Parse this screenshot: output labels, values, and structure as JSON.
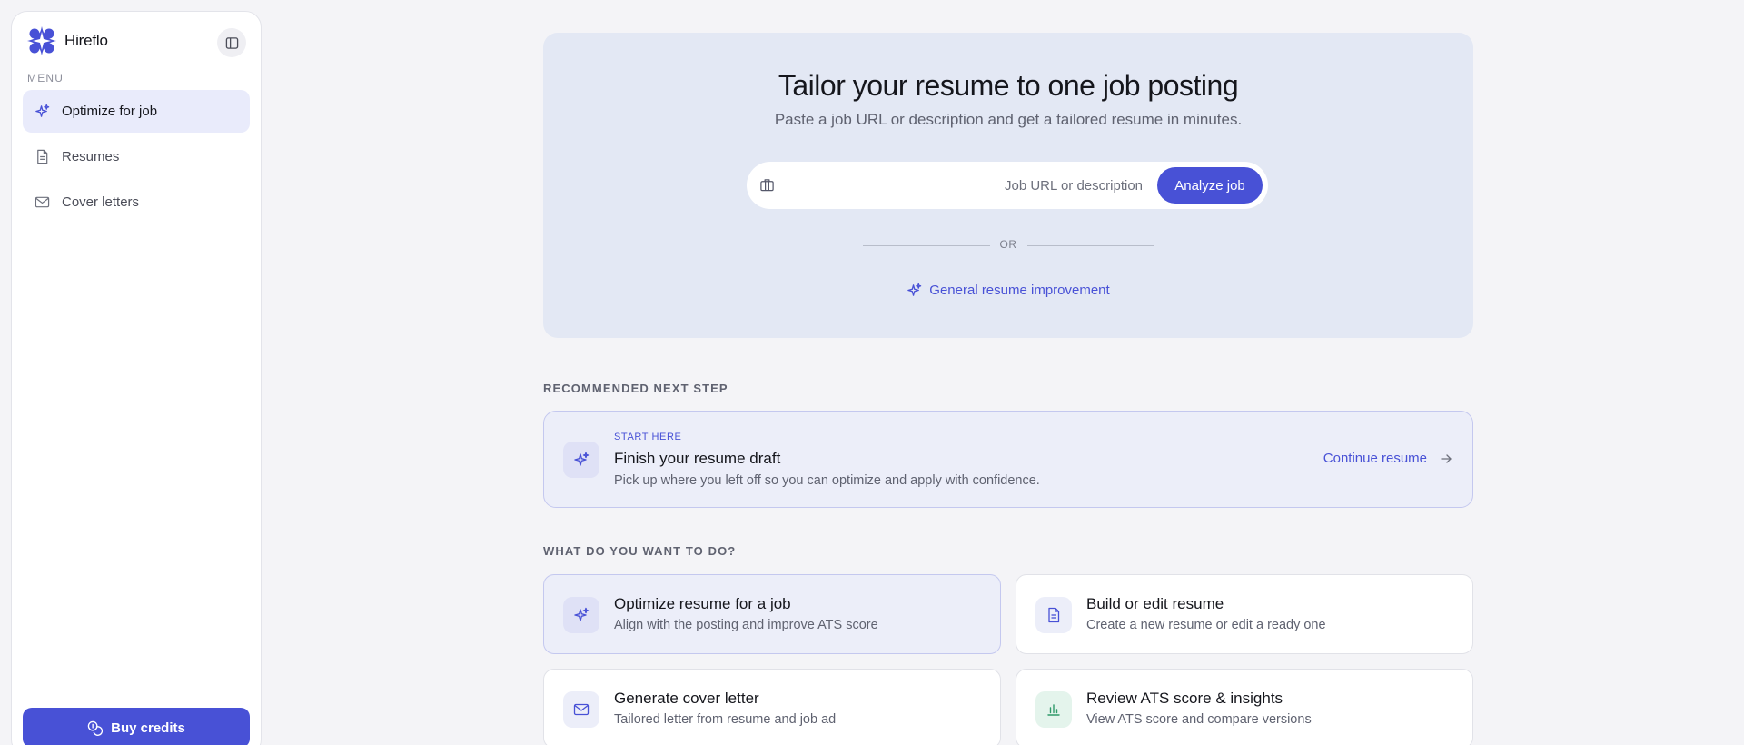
{
  "app": {
    "name": "Hireflo",
    "brand_color": "#4851d6"
  },
  "sidebar": {
    "menu_heading": "MENU",
    "items": [
      {
        "label": "Optimize for job",
        "icon": "sparkle-icon",
        "active": true
      },
      {
        "label": "Resumes",
        "icon": "document-icon",
        "active": false
      },
      {
        "label": "Cover letters",
        "icon": "mail-icon",
        "active": false
      }
    ],
    "buy_credits_label": "Buy credits"
  },
  "hero": {
    "title": "Tailor your resume to one job posting",
    "subtitle": "Paste a job URL or description and get a tailored resume in minutes.",
    "input_placeholder": "Job URL or description",
    "input_value": "",
    "analyze_label": "Analyze job",
    "or_label": "OR",
    "general_link_label": "General resume improvement"
  },
  "recommended": {
    "heading": "RECOMMENDED NEXT STEP",
    "eyebrow": "START HERE",
    "title": "Finish your resume draft",
    "description": "Pick up where you left off so you can optimize and apply with confidence.",
    "cta_label": "Continue resume"
  },
  "actions": {
    "heading": "WHAT DO YOU WANT TO DO?",
    "cards": [
      {
        "title": "Optimize resume for a job",
        "description": "Align with the posting and improve ATS score",
        "icon": "sparkle-icon",
        "selected": true
      },
      {
        "title": "Build or edit resume",
        "description": "Create a new resume or edit a ready one",
        "icon": "document-icon",
        "selected": false
      },
      {
        "title": "Generate cover letter",
        "description": "Tailored letter from resume and job ad",
        "icon": "mail-icon",
        "selected": false
      },
      {
        "title": "Review ATS score & insights",
        "description": "View ATS score and compare versions",
        "icon": "bar-chart-icon",
        "selected": false
      }
    ]
  },
  "colors": {
    "accent": "#4851d6",
    "hero_bg": "#e3e8f4",
    "selected_bg": "#eceef9",
    "ats_icon_bg": "#e4f4ec",
    "ats_icon": "#2f9a6a"
  }
}
